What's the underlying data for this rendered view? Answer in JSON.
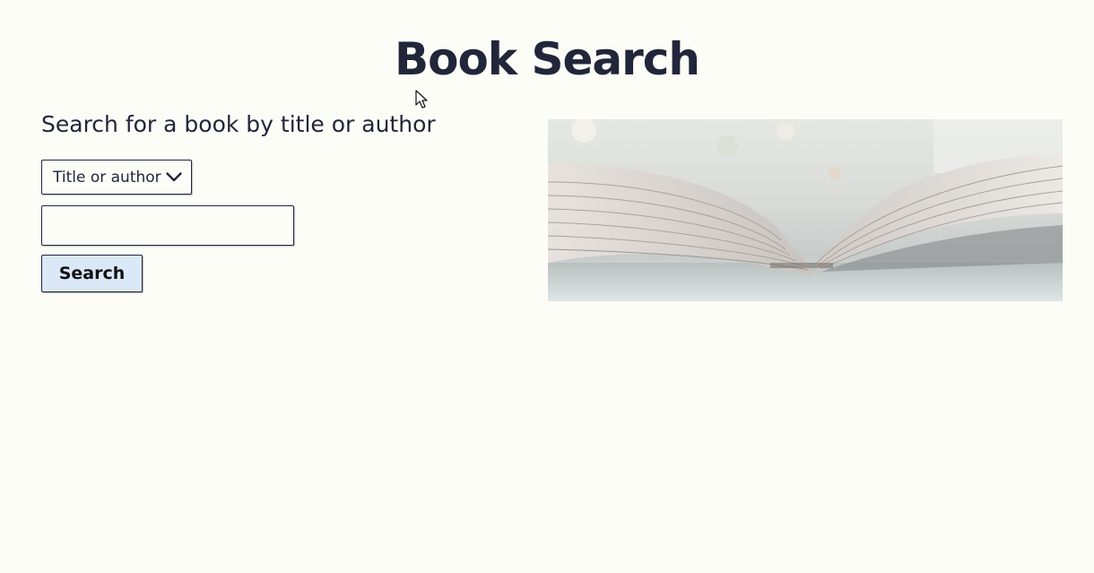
{
  "page": {
    "title": "Book Search",
    "subtitle": "Search for a book by title or author"
  },
  "form": {
    "select": {
      "selected": "Title or author"
    },
    "search_input": {
      "value": "",
      "placeholder": ""
    },
    "search_button_label": "Search"
  },
  "hero_image": {
    "subject": "open-book-photo"
  },
  "colors": {
    "background": "#fdfdf8",
    "text": "#22263a",
    "button_bg": "#dbe8f8"
  },
  "icons": {
    "select_chevron": "chevron-down-icon",
    "cursor": "mouse-pointer-icon"
  }
}
